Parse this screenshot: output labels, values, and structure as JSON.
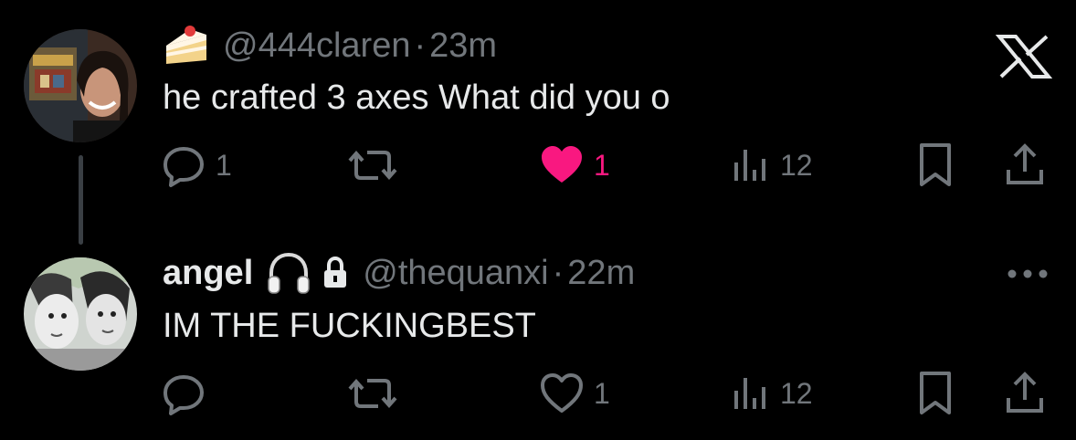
{
  "colors": {
    "background": "#000000",
    "text_primary": "#e7e9ea",
    "text_secondary": "#71767b",
    "like_active": "#f91880"
  },
  "tweets": [
    {
      "avatar_icon": "avatar-photo",
      "emoji_icon": "cake-icon",
      "handle": "@444claren",
      "separator": "·",
      "time": "23m",
      "text": "he crafted 3 axes What did you o",
      "actions": {
        "reply_count": "1",
        "retweet_count": "",
        "like_count": "1",
        "liked": true,
        "views_count": "12"
      }
    },
    {
      "avatar_icon": "avatar-illustration",
      "name": "angel",
      "headphones_icon": "headphones-icon",
      "lock_icon": "lock-icon",
      "handle": "@thequanxi",
      "separator": "·",
      "time": "22m",
      "text": "IM THE FUCKINGBEST",
      "actions": {
        "reply_count": "",
        "retweet_count": "",
        "like_count": "1",
        "liked": false,
        "views_count": "12"
      }
    }
  ],
  "close_icon": "x-close-icon",
  "more_icon": "more-options-icon"
}
